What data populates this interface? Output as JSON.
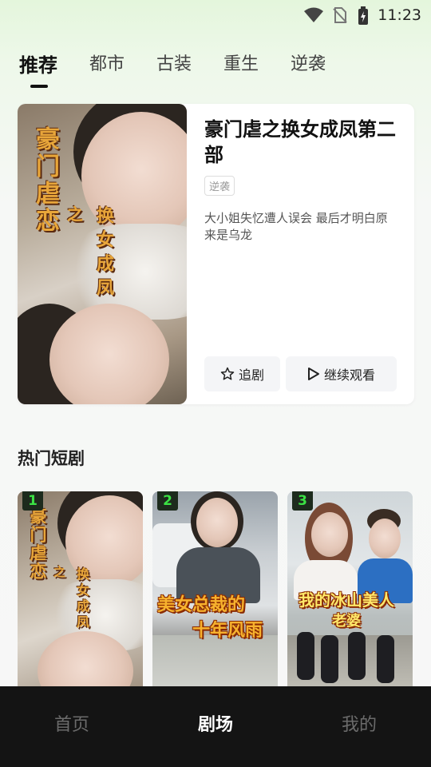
{
  "status_bar": {
    "time": "11:23",
    "icons": [
      "wifi-icon",
      "no-sim-icon",
      "battery-charging-icon"
    ]
  },
  "top_tabs": [
    {
      "label": "推荐",
      "active": true
    },
    {
      "label": "都市",
      "active": false
    },
    {
      "label": "古装",
      "active": false
    },
    {
      "label": "重生",
      "active": false
    },
    {
      "label": "逆袭",
      "active": false
    }
  ],
  "featured": {
    "poster_title_vertical": "豪门虐恋",
    "poster_title_small": "之",
    "poster_title_right": "换女成凤",
    "title": "豪门虐之换女成凤第二部",
    "tag": "逆袭",
    "description": "大小姐失忆遭人误会 最后才明白原来是乌龙",
    "follow_label": "追剧",
    "continue_label": "继续观看"
  },
  "hot_section": {
    "title": "热门短剧",
    "cards": [
      {
        "rank": "1",
        "poster_text_a": "豪门虐恋",
        "poster_text_b": "之",
        "poster_text_c": "换女成凤"
      },
      {
        "rank": "2",
        "poster_text_a": "美女总裁的",
        "poster_text_b": "十年风雨"
      },
      {
        "rank": "3",
        "poster_text_a": "我的冰山美人",
        "poster_text_b": "老婆"
      }
    ]
  },
  "bottom_nav": [
    {
      "label": "首页",
      "active": false
    },
    {
      "label": "剧场",
      "active": true
    },
    {
      "label": "我的",
      "active": false
    }
  ],
  "colors": {
    "rank_text": "#3be244",
    "accent_dark": "#141414"
  }
}
